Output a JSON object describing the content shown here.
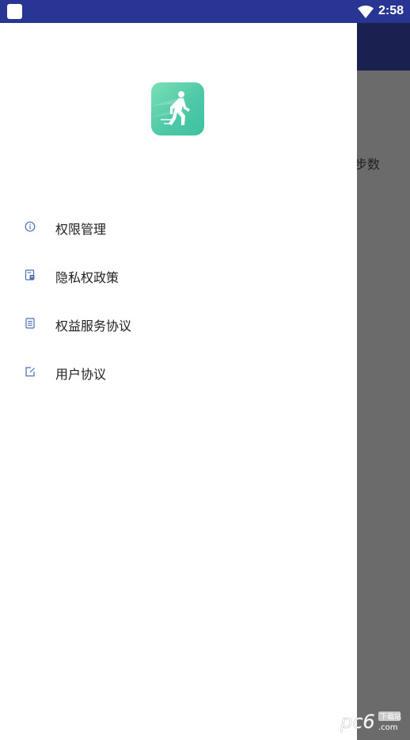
{
  "status_bar": {
    "time": "2:58",
    "icons": [
      "app-icon",
      "wifi-icon"
    ]
  },
  "background_app": {
    "partial_label": "步数"
  },
  "drawer": {
    "logo": {
      "icon": "walking-person-icon",
      "colors": [
        "#7be0b6",
        "#3ec1a0"
      ]
    },
    "menu": [
      {
        "label": "权限管理",
        "icon": "info-circle-icon"
      },
      {
        "label": "隐私权政策",
        "icon": "privacy-doc-icon"
      },
      {
        "label": "权益服务协议",
        "icon": "document-icon"
      },
      {
        "label": "用户协议",
        "icon": "edit-note-icon"
      }
    ]
  },
  "watermark": {
    "text": "pc6",
    "sub": "下载站",
    "domain": ".com"
  },
  "colors": {
    "status_bar": "#283593",
    "toolbar": "#1a2151",
    "scrim": "#6b6b6b",
    "icon_blue": "#4a6fb5",
    "accent_green": "#4fc9a7"
  }
}
